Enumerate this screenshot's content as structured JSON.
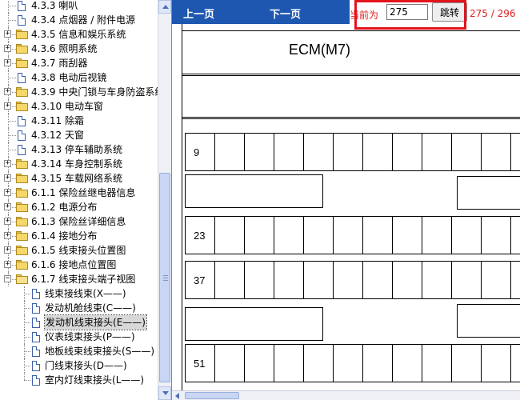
{
  "tree": {
    "items": [
      {
        "num": "4.3.3",
        "label": "喇叭",
        "type": "page"
      },
      {
        "num": "4.3.4",
        "label": "点烟器 / 附件电源",
        "type": "page"
      },
      {
        "num": "4.3.5",
        "label": "信息和娱乐系统",
        "type": "folder"
      },
      {
        "num": "4.3.6",
        "label": "照明系统",
        "type": "folder"
      },
      {
        "num": "4.3.7",
        "label": "雨刮器",
        "type": "folder"
      },
      {
        "num": "4.3.8",
        "label": "电动后视镜",
        "type": "page"
      },
      {
        "num": "4.3.9",
        "label": "中央门锁与车身防盗系统",
        "type": "folder"
      },
      {
        "num": "4.3.10",
        "label": "电动车窗",
        "type": "folder"
      },
      {
        "num": "4.3.11",
        "label": "除霜",
        "type": "page"
      },
      {
        "num": "4.3.12",
        "label": "天窗",
        "type": "page"
      },
      {
        "num": "4.3.13",
        "label": "停车辅助系统",
        "type": "page"
      },
      {
        "num": "4.3.14",
        "label": "车身控制系统",
        "type": "folder"
      },
      {
        "num": "4.3.15",
        "label": "车载网络系统",
        "type": "folder"
      },
      {
        "num": "6.1.1",
        "label": "保险丝继电器信息",
        "type": "folder"
      },
      {
        "num": "6.1.2",
        "label": "电源分布",
        "type": "folder"
      },
      {
        "num": "6.1.3",
        "label": "保险丝详细信息",
        "type": "folder"
      },
      {
        "num": "6.1.4",
        "label": "接地分布",
        "type": "folder"
      },
      {
        "num": "6.1.5",
        "label": "线束接头位置图",
        "type": "folder"
      },
      {
        "num": "6.1.6",
        "label": "接地点位置图",
        "type": "folder"
      },
      {
        "num": "6.1.7",
        "label": "线束接头端子视图",
        "type": "folder-open"
      }
    ],
    "children": [
      {
        "label": "线束接线束",
        "code": "(X——)"
      },
      {
        "label": "发动机舱线束",
        "code": "(C——)"
      },
      {
        "label": "发动机线束接头",
        "code": "(E——)",
        "selected": true
      },
      {
        "label": "仪表线束接头",
        "code": "(P——)"
      },
      {
        "label": "地板线束线束接头",
        "code": "(S——)"
      },
      {
        "label": "门线束接头",
        "code": "(D——)"
      },
      {
        "label": "室内灯线束接头",
        "code": "(L——)"
      }
    ],
    "expander_plus": "+",
    "expander_minus": "−"
  },
  "nav": {
    "prev": "上一页",
    "next": "下一页",
    "current_label": "当前为",
    "page_value": "275",
    "go_button": "跳转",
    "page_count": "275 / 296"
  },
  "diagram": {
    "title": "ECM(M7)",
    "row_labels": [
      "9",
      "23",
      "37",
      "51"
    ]
  },
  "colors": {
    "nav_bar": "#1d57b0",
    "highlight": "#e3141c",
    "red_text": "#e02020"
  }
}
